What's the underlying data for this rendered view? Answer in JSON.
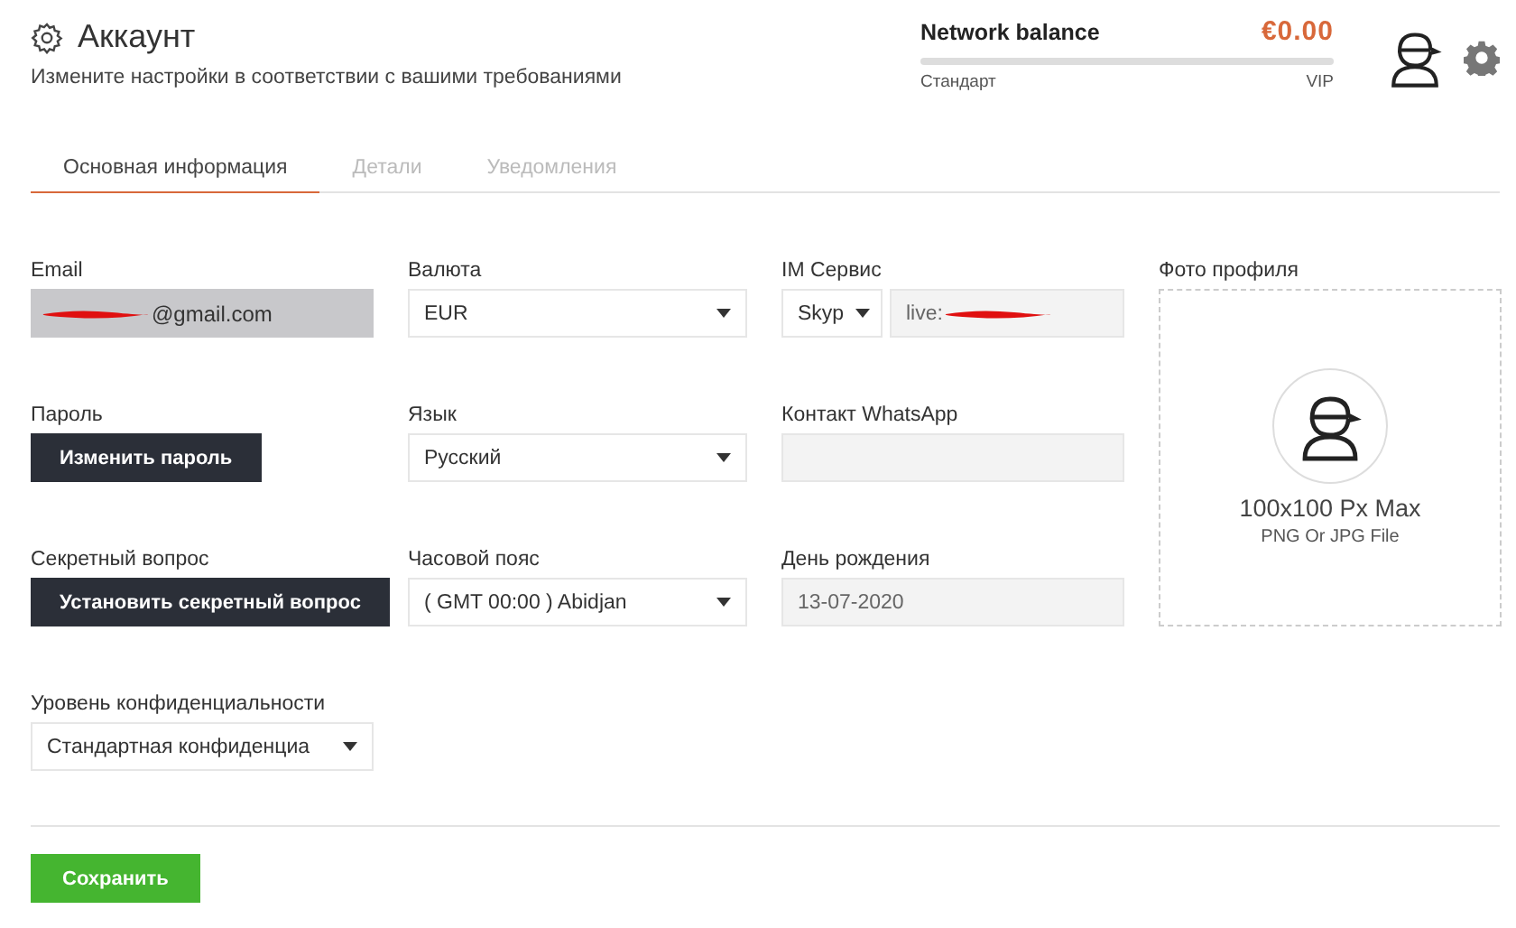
{
  "header": {
    "title": "Аккаунт",
    "subtitle": "Измените настройки в соответствии с вашими требованиями"
  },
  "balance": {
    "label": "Network balance",
    "amount": "€0.00",
    "level": 0,
    "min_label": "Стандарт",
    "max_label": "VIP"
  },
  "tabs": [
    {
      "label": "Основная информация",
      "selected": true
    },
    {
      "label": "Детали",
      "selected": false
    },
    {
      "label": "Уведомления",
      "selected": false
    }
  ],
  "fields": [
    {
      "label": "Email",
      "kind": "readonly",
      "value": "@gmail.com",
      "redacted": true
    },
    {
      "label": "Валюта",
      "kind": "select",
      "value": "EUR"
    },
    {
      "label": "IM Сервис",
      "kind": "im",
      "service": "Skyp",
      "value": "live:",
      "redacted": true
    },
    {
      "label": "Пароль",
      "kind": "button",
      "value": "Изменить пароль"
    },
    {
      "label": "Язык",
      "kind": "select",
      "value": "Русский"
    },
    {
      "label": "Контакт WhatsApp",
      "kind": "input",
      "disabled": true
    },
    {
      "label": "Секретный вопрос",
      "kind": "button",
      "value": "Установить секретный вопрос"
    },
    {
      "label": "Часовой пояс",
      "kind": "select",
      "value": "( GMT 00:00 ) Abidjan"
    },
    {
      "label": "День рождения",
      "kind": "input",
      "disabled": true,
      "value": "13-07-2020"
    },
    {
      "label": "Уровень конфиденциальности",
      "kind": "select",
      "value": "Стандартная конфиденциа"
    }
  ],
  "photo": {
    "label": "Фото профиля",
    "size_hint": "100x100 Px Max",
    "format_hint": "PNG Or JPG File"
  },
  "save_button": "Сохранить"
}
